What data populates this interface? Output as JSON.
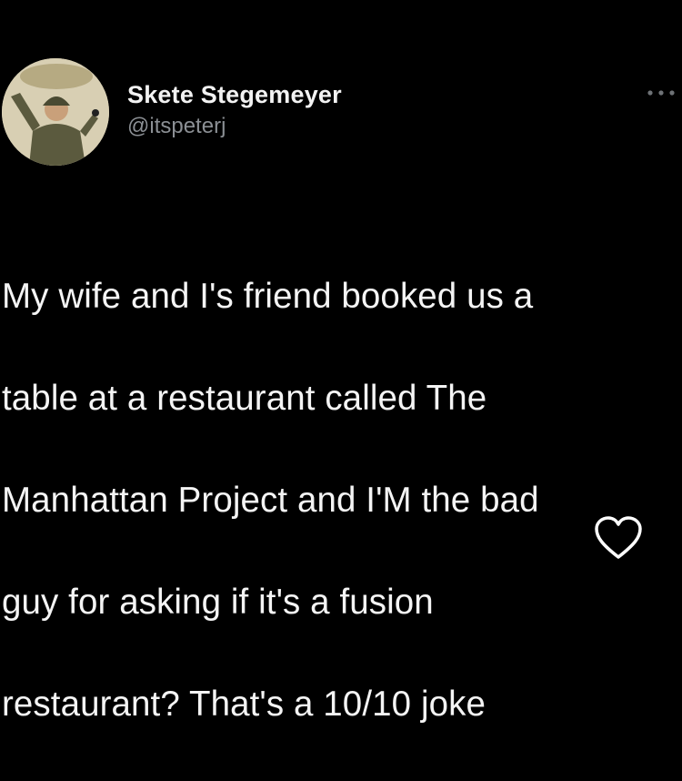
{
  "tweet": {
    "author": {
      "display_name": "Skete Stegemeyer",
      "handle": "@itspeterj",
      "avatar_icon": "avatar-image"
    },
    "more_icon": "more-options-icon",
    "body_lines": [
      "My wife and I's friend booked us a",
      "table at a restaurant called The",
      "Manhattan Project and I'M the bad",
      "guy for asking if it's a fusion",
      "restaurant?  That's a 10/10 joke"
    ],
    "like_icon": "heart-outline-icon"
  },
  "colors": {
    "background": "#000000",
    "name": "#f2f2f2",
    "handle": "#8b8f94",
    "text": "#f4f4f4"
  }
}
